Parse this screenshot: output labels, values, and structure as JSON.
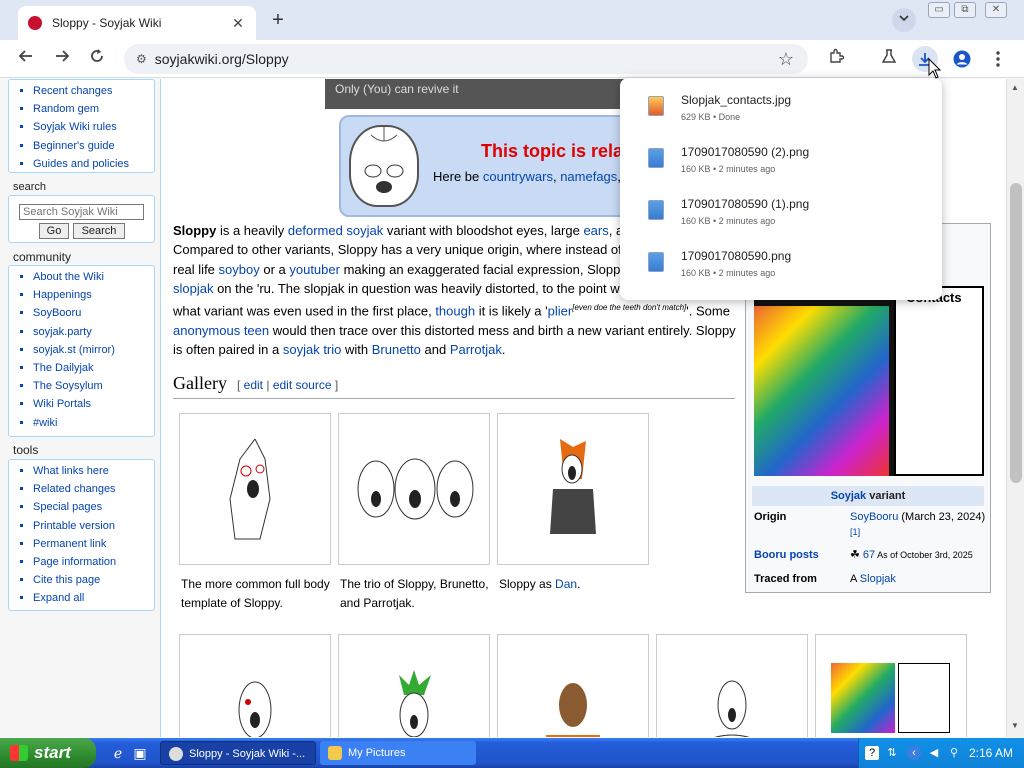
{
  "browser": {
    "tab_title": "Sloppy - Soyjak Wiki",
    "tab_close": "✕",
    "new_tab": "+",
    "url": "soyjakwiki.org/Sloppy",
    "window_min": "▭",
    "window_max": "⧉",
    "window_close": "✕"
  },
  "toolbar_icons": [
    "back-icon",
    "forward-icon",
    "reload-icon",
    "site-info-icon",
    "bookmark-star-icon",
    "extensions-icon",
    "labs-icon",
    "downloads-icon",
    "profile-icon",
    "menu-icon"
  ],
  "sidebar": {
    "nav_items": [
      "Recent changes",
      "Random gem",
      "Soyjak Wiki rules",
      "Beginner's guide",
      "Guides and policies"
    ],
    "search_title": "search",
    "search_placeholder": "Search Soyjak Wiki",
    "go_label": "Go",
    "search_label": "Search",
    "community_title": "community",
    "community_items": [
      "About the Wiki",
      "Happenings",
      "SoyBooru",
      "soyjak.party",
      "soyjak.st (mirror)",
      "The Dailyjak",
      "The Soysylum",
      "Wiki Portals",
      "#wiki"
    ],
    "tools_title": "tools",
    "tools_items": [
      "What links here",
      "Related changes",
      "Special pages",
      "Printable version",
      "Permanent link",
      "Page information",
      "Cite this page",
      "Expand all"
    ]
  },
  "article": {
    "top_banner": "Only (You) can revive it",
    "notice_title": "This topic is rela",
    "notice_prefix": "Here be ",
    "notice_link1": "countrywars",
    "notice_sep": ", ",
    "notice_link2": "namefags",
    "notice_tail": ", s",
    "para": {
      "s1": "Sloppy",
      "s2": " is a heavily ",
      "l1": "deformed soyjak",
      "s3": " variant with bloodshot eyes, large ",
      "l2": "ears",
      "s4": ", an",
      "s5": "Compared to other variants, Sloppy has a very unique origin, where instead of b",
      "s6": "real life ",
      "l3": "soyboy",
      "s7": " or a ",
      "l4": "youtuber",
      "s8": " making an exaggerated facial expression, Sloppy v",
      "l5": "slopjak",
      "s9": " on the 'ru. The slopjak in question was heavily distorted, to the point whe",
      "s10": "what variant was even used in the first place, ",
      "l6": "though",
      "s11": " it is likely a '",
      "l7": "plier",
      "sup": "[even doe the teeth don't match]",
      "s12": "'. Some",
      "l8": "anonymous teen",
      "s13": " would then trace over this distorted mess and birth a new variant entirely. Sloppy",
      "s14": "is often paired in a ",
      "l9": "soyjak trio",
      "s15": " with ",
      "l10": "Brunetto",
      "s16": " and ",
      "l11": "Parrotjak",
      "s17": "."
    },
    "gallery_title": "Gallery",
    "gallery_edit_open": "[ ",
    "gallery_edit": "edit",
    "gallery_pipe": " | ",
    "gallery_edit_source": "edit source",
    "gallery_edit_close": " ]",
    "captions": {
      "c1": "The more common full body template of Sloppy.",
      "c2": "The trio of Sloppy, Brunetto, and Parrotjak.",
      "c3_prefix": "Sloppy as ",
      "c3_link": "Dan",
      "c3_suffix": "."
    }
  },
  "infobox": {
    "image_label": "Contacts",
    "caption_link": "Soyjak",
    "caption_suffix": " variant",
    "origin_key": "Origin",
    "origin_link": "SoyBooru",
    "origin_val": " (March 23, 2024)",
    "origin_ref": "[1]",
    "booru_key": "Booru posts",
    "booru_count": "67",
    "booru_asof": " As of October 3rd, 2025",
    "traced_key": "Traced from",
    "traced_prefix": "A ",
    "traced_link": "Slopjak"
  },
  "downloads": [
    {
      "name": "Slopjak_contacts.jpg",
      "meta": "629 KB • Done",
      "type": "jpg"
    },
    {
      "name": "1709017080590 (2).png",
      "meta": "160 KB • 2 minutes ago",
      "type": "png"
    },
    {
      "name": "1709017080590 (1).png",
      "meta": "160 KB • 2 minutes ago",
      "type": "png"
    },
    {
      "name": "1709017080590.png",
      "meta": "160 KB • 2 minutes ago",
      "type": "png"
    }
  ],
  "taskbar": {
    "start": "start",
    "task1": "Sloppy - Soyjak Wiki -...",
    "task2": "My Pictures",
    "clock": "2:16 AM"
  },
  "colors": {
    "link": "#0645ad",
    "notice_red": "#e00000",
    "taskbar": "#245edb",
    "start_green": "#2e8b2e"
  }
}
